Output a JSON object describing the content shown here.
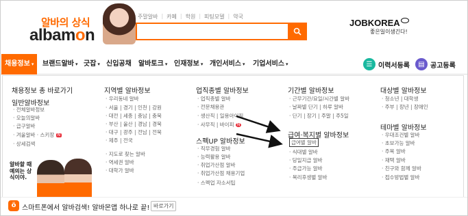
{
  "header": {
    "logo_ko": "알바의 상식",
    "logo_en_pre": "albam",
    "logo_en_o": "o",
    "logo_en_post": "n",
    "quick_links": [
      "주말알바",
      "카페",
      "학원",
      "피팅모델",
      "약국"
    ],
    "jobkorea_logo": "JOBKOREA",
    "jobkorea_sub": "좋은일이생긴다!"
  },
  "nav": {
    "items": [
      "채용정보",
      "브랜드알바",
      "긋잡",
      "신입공채",
      "알바토크",
      "인재정보",
      "개인서비스",
      "기업서비스"
    ],
    "resume_label": "이력서등록",
    "post_label": "공고등록"
  },
  "menu": {
    "total": "채용정보 총 바로가기",
    "general": {
      "title": "일반알바정보",
      "items": [
        "전체알바정보",
        "오늘의알바",
        "급구알바",
        "겨울알바 · 스키장",
        "상세검색"
      ],
      "badge": "N"
    },
    "region": {
      "title": "지역별 알바정보",
      "row1": "우리동네 알바",
      "grid": [
        "서울 | 경기 | 인천 | 강원",
        "대전 | 세종 | 충남 | 충북",
        "부산 | 울산 | 경남 | 경북",
        "대구 | 광주 | 전남 | 전북",
        "제주 | 전국"
      ],
      "items": [
        "지도로 찾는 알바",
        "역세권 알바",
        "대학가 알바"
      ]
    },
    "industry": {
      "title": "업직종별 알바정보",
      "items": [
        "업직종별 알바",
        "전문채용관",
        "생산직 | 일용아이픽",
        "사무직 | 바이피"
      ],
      "badge": "N"
    },
    "spec": {
      "title": "스펙UP 알바정보",
      "items": [
        "직무경험 알바",
        "능력활용 알바",
        "취업가산점 알바",
        "취업가산점 채용기업",
        "스펙업 자소서팁"
      ]
    },
    "period": {
      "title": "기간별 알바정보",
      "items": [
        "근무기간/요일/시간별 알바",
        "날짜별 단기 | 하루 알바",
        "단기 | 장기 | 주말 | 주5일"
      ]
    },
    "welfare": {
      "title": "급여·복지별 알바정보",
      "items": [
        "급여별 알바",
        "식대별 알바",
        "당일지급 알바",
        "주급가능 알바",
        "복리후생별 알바"
      ]
    },
    "target": {
      "title": "대상별 알바정보",
      "items": [
        "청소년 | 대학생",
        "주부 | 장년 | 장애인"
      ]
    },
    "theme": {
      "title": "테마별 알바정보",
      "items": [
        "우대조건별 알바",
        "초보가능 알바",
        "주목 알바",
        "재택 알바",
        "친구와 함께 알바",
        "접수방법별 알바"
      ]
    },
    "promo": "알바할 때 예의는 상식이야."
  },
  "bottom": {
    "text": "스마트폰에서 알바검색! 알바몬앱 하나로 끝!",
    "link": "바로가기"
  },
  "colors": {
    "accent": "#ff6a00",
    "resume": "#19b89f",
    "post": "#6a5acd"
  }
}
